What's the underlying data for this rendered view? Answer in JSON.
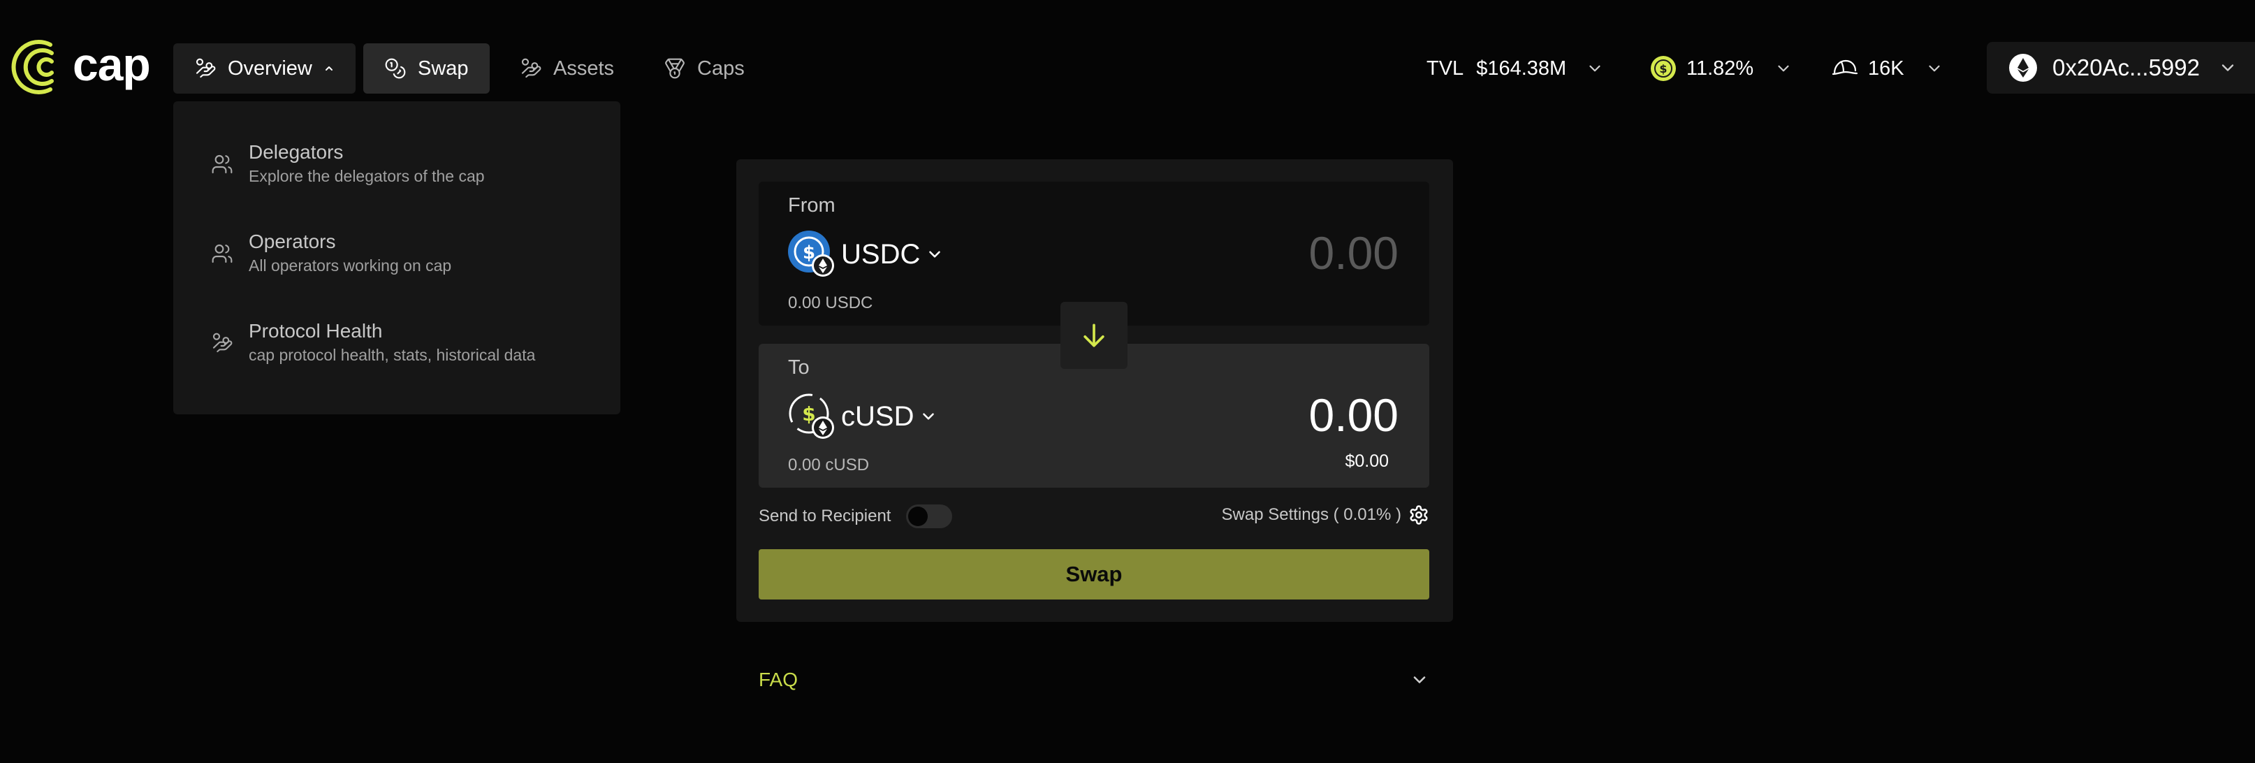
{
  "brand": {
    "name": "cap",
    "accent_color": "#d4e84c",
    "swap_button_color": "#858b36"
  },
  "nav": {
    "items": [
      {
        "label": "Overview",
        "icon": "hand-coins-icon",
        "has_caret": true,
        "state": "open"
      },
      {
        "label": "Swap",
        "icon": "coins-icon",
        "state": "current"
      },
      {
        "label": "Assets",
        "icon": "hand-coins-icon"
      },
      {
        "label": "Caps",
        "icon": "medal-icon"
      }
    ]
  },
  "stats": {
    "tvl_label": "TVL",
    "tvl_value": "$164.38M",
    "apy_value": "11.82%",
    "apy_icon": "dollar-coin-icon",
    "holders_value": "16K",
    "holders_icon": "helmet-icon"
  },
  "wallet": {
    "address": "0x20Ac...5992",
    "network_icon": "ethereum-icon"
  },
  "overview_menu": {
    "items": [
      {
        "title": "Delegators",
        "subtitle": "Explore the delegators of the cap",
        "icon": "users-icon"
      },
      {
        "title": "Operators",
        "subtitle": "All operators working on cap",
        "icon": "users-icon"
      },
      {
        "title": "Protocol Health",
        "subtitle": "cap protocol health, stats, historical data",
        "icon": "hand-coins-icon"
      }
    ]
  },
  "swap": {
    "from": {
      "label": "From",
      "token": "USDC",
      "amount_placeholder": "0.00",
      "balance": "0.00 USDC"
    },
    "to": {
      "label": "To",
      "token": "cUSD",
      "amount": "0.00",
      "usd_value": "$0.00",
      "balance": "0.00 cUSD"
    },
    "send_to_recipient_label": "Send to Recipient",
    "send_to_recipient_enabled": false,
    "settings_label": "Swap Settings ( 0.01% )",
    "button_label": "Swap"
  },
  "faq": {
    "label": "FAQ"
  }
}
